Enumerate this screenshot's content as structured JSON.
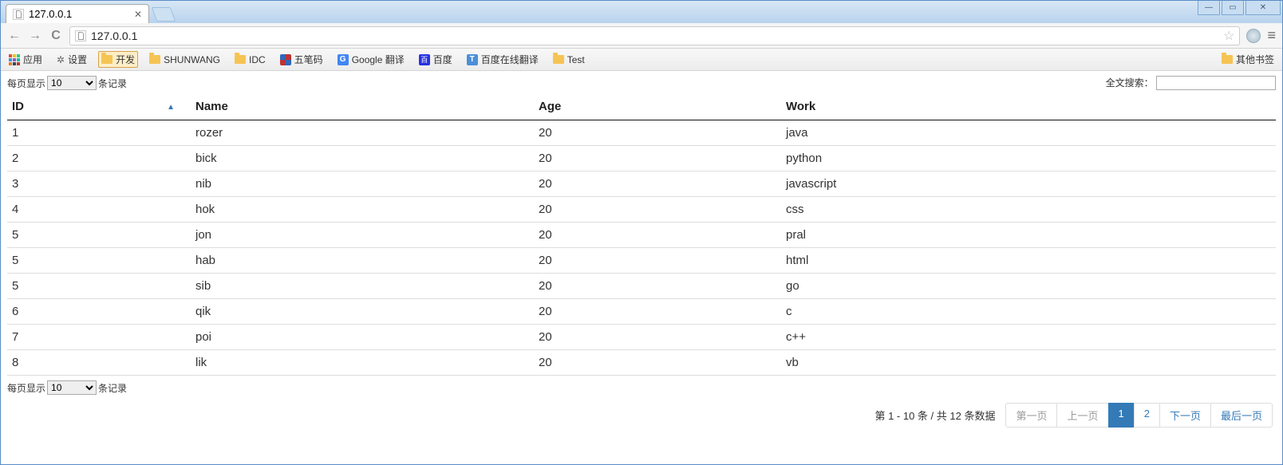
{
  "browser": {
    "tab_title": "127.0.0.1",
    "url": "127.0.0.1",
    "window_controls": {
      "min": "—",
      "max": "▭",
      "close": "✕"
    },
    "nav": {
      "back": "←",
      "forward": "→",
      "reload": "C",
      "menu": "≡",
      "star": "☆"
    }
  },
  "bookmarks": {
    "apps": "应用",
    "settings": "设置",
    "dev": "开发",
    "shunwang": "SHUNWANG",
    "idc": "IDC",
    "wubi": "五笔码",
    "gtrans": "Google 翻译",
    "baidu": "百度",
    "baidu_trans": "百度在线翻译",
    "test": "Test",
    "other": "其他书签"
  },
  "datatable": {
    "length_prefix": "每页显示",
    "length_value": "10",
    "length_suffix": "条记录",
    "search_label": "全文搜索：",
    "columns": [
      "ID",
      "Name",
      "Age",
      "Work"
    ],
    "rows": [
      {
        "id": "1",
        "name": "rozer",
        "age": "20",
        "work": "java"
      },
      {
        "id": "2",
        "name": "bick",
        "age": "20",
        "work": "python"
      },
      {
        "id": "3",
        "name": "nib",
        "age": "20",
        "work": "javascript"
      },
      {
        "id": "4",
        "name": "hok",
        "age": "20",
        "work": "css"
      },
      {
        "id": "5",
        "name": "jon",
        "age": "20",
        "work": "pral"
      },
      {
        "id": "5",
        "name": "hab",
        "age": "20",
        "work": "html"
      },
      {
        "id": "5",
        "name": "sib",
        "age": "20",
        "work": "go"
      },
      {
        "id": "6",
        "name": "qik",
        "age": "20",
        "work": "c"
      },
      {
        "id": "7",
        "name": "poi",
        "age": "20",
        "work": "c++"
      },
      {
        "id": "8",
        "name": "lik",
        "age": "20",
        "work": "vb"
      }
    ],
    "info": "第 1 - 10 条 / 共 12 条数据",
    "pager": {
      "first": "第一页",
      "prev": "上一页",
      "p1": "1",
      "p2": "2",
      "next": "下一页",
      "last": "最后一页"
    }
  }
}
